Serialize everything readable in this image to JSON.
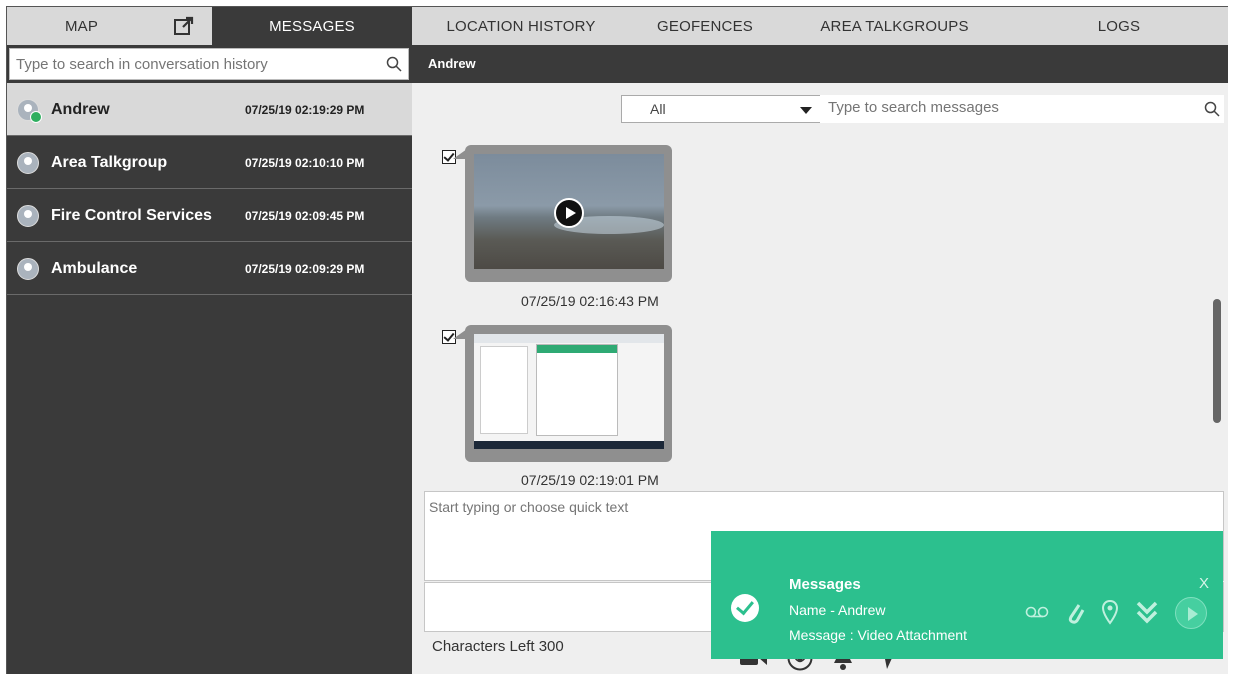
{
  "tabs": {
    "map": "MAP",
    "messages": "MESSAGES",
    "location_history": "LOCATION HISTORY",
    "geofences": "GEOFENCES",
    "area_talkgroups": "AREA TALKGROUPS",
    "logs": "LOGS"
  },
  "conversation_search": {
    "placeholder": "Type to search in conversation history"
  },
  "conversations": [
    {
      "name": "Andrew",
      "time": "07/25/19 02:19:29 PM",
      "icon": "user-icon"
    },
    {
      "name": "Area Talkgroup",
      "time": "07/25/19 02:10:10 PM",
      "icon": "group-icon"
    },
    {
      "name": "Fire Control Services",
      "time": "07/25/19 02:09:45 PM",
      "icon": "truck-icon"
    },
    {
      "name": "Ambulance",
      "time": "07/25/19 02:09:29 PM",
      "icon": "group-icon"
    }
  ],
  "chat": {
    "header": "Andrew",
    "filter": "All",
    "search_placeholder": "Type to search messages",
    "messages": [
      {
        "type": "video",
        "time": "07/25/19 02:16:43 PM"
      },
      {
        "type": "image",
        "time": "07/25/19 02:19:01 PM"
      }
    ],
    "composer_placeholder": "Start typing or choose quick text",
    "chars_left": "Characters Left 300"
  },
  "toast": {
    "title": "Messages",
    "name": "Name - Andrew",
    "message": "Message : Video Attachment",
    "close": "X"
  },
  "colors": {
    "toast": "#2cc08e",
    "dark": "#3a3a3a",
    "tab_light": "#d9d9d9"
  }
}
